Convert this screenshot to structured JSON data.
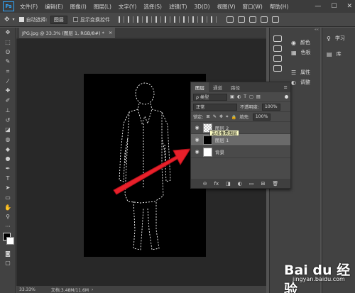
{
  "app": {
    "logo": "Ps"
  },
  "menu": [
    "文件(F)",
    "编辑(E)",
    "图像(I)",
    "图层(L)",
    "文字(Y)",
    "选择(S)",
    "滤镜(T)",
    "3D(D)",
    "视图(V)",
    "窗口(W)",
    "帮助(H)"
  ],
  "window_controls": [
    "—",
    "☐",
    "✕"
  ],
  "options": {
    "auto_select_label": "自动选择:",
    "auto_select_value": "图层",
    "show_transform_label": "显示变换控件"
  },
  "document": {
    "tab_title": "JPG.jpg @ 33.3% (图层 1, RGB/8#) *",
    "close": "×"
  },
  "status": {
    "zoom": "33.33%",
    "doc_info": "文档:3.48M/11.6M"
  },
  "panels_collapsed": [
    {
      "icon": "color-icon",
      "label": "颜色"
    },
    {
      "icon": "swatches-icon",
      "label": "色板"
    },
    {
      "icon": "properties-icon",
      "label": "属性"
    },
    {
      "icon": "adjustments-icon",
      "label": "调整"
    }
  ],
  "panels_right": [
    {
      "icon": "learn-icon",
      "label": "学习"
    },
    {
      "icon": "libraries-icon",
      "label": "库"
    }
  ],
  "layers_panel": {
    "tabs": [
      "图层",
      "通道",
      "路径"
    ],
    "filter_kind": "ρ 类型",
    "blend_mode": "正常",
    "opacity_label": "不透明度:",
    "opacity_value": "100%",
    "lock_label": "锁定:",
    "fill_label": "填充:",
    "fill_value": "100%",
    "layers": [
      {
        "name": "图层 2",
        "thumb": "checker",
        "selected": false
      },
      {
        "name": "图层 1",
        "thumb": "dark",
        "selected": true,
        "tooltip": "选择像素图层"
      },
      {
        "name": "背景",
        "thumb": "white",
        "selected": false
      }
    ],
    "footer_icons": [
      "link-icon",
      "fx-icon",
      "mask-icon",
      "adjustment-layer-icon",
      "group-icon",
      "new-layer-icon",
      "trash-icon"
    ],
    "footer_glyphs": [
      "⊝",
      "fx",
      "◨",
      "◐",
      "▭",
      "⊞",
      "🗑"
    ]
  },
  "watermark": {
    "brand": "Bai du 经验",
    "url": "jingyan.baidu.com"
  }
}
